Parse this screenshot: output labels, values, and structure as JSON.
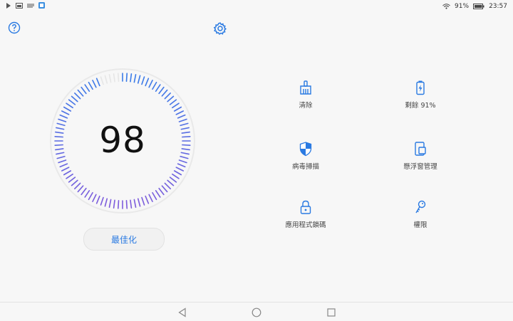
{
  "status_bar": {
    "battery": "91%",
    "time": "23:57"
  },
  "score": "98",
  "optimize_label": "最佳化",
  "tools": {
    "clean": "清除",
    "battery": "剩餘 91%",
    "virus_scan": "病毒掃描",
    "floating_window": "懸浮窗管理",
    "app_lock": "應用程式鎖碼",
    "permissions": "權限"
  },
  "colors": {
    "accent": "#2a7ae2",
    "gauge_top": "#3a7be8",
    "gauge_bottom": "#7e5cdc"
  }
}
